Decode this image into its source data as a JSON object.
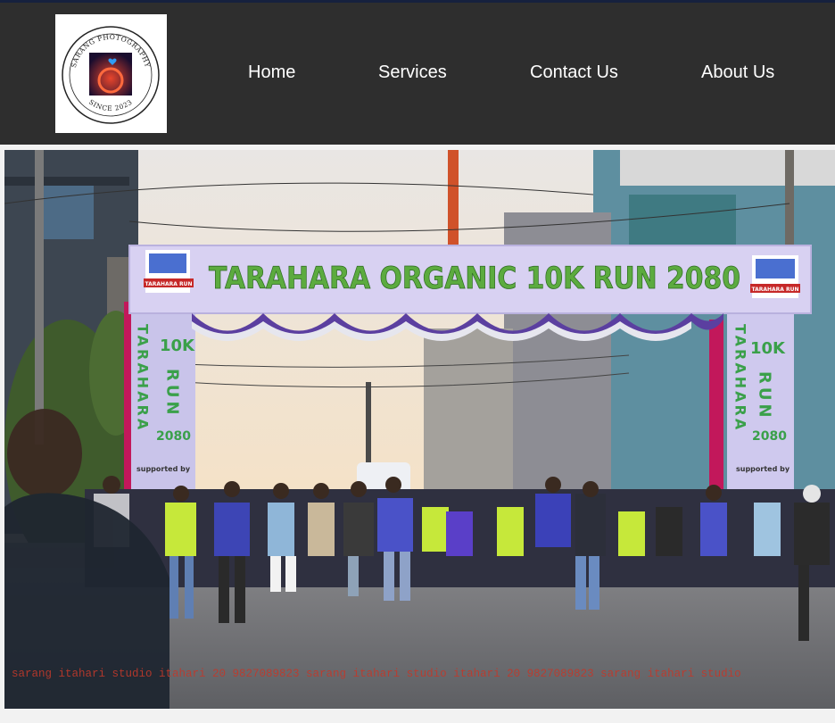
{
  "brand": {
    "logo_top_text": "SARANG PHOTOGRAPHY",
    "logo_bottom_text": "SINCE 2023"
  },
  "nav": {
    "items": [
      {
        "label": "Home"
      },
      {
        "label": "Services"
      },
      {
        "label": "Contact Us"
      },
      {
        "label": "About Us"
      }
    ]
  },
  "hero": {
    "banner_title": "TARAHARA ORGANIC 10K RUN 2080",
    "left_pillar_vertical": "TARAHARA",
    "pillar_10k": "10K",
    "pillar_run_vertical": "RUN",
    "pillar_year": "2080",
    "supported_by": "supported by",
    "badge_text": "TARAHARA RUN",
    "watermark": "sarang itahari studio itahari 20 9827089823 sarang itahari studio itahari 20 9827089823 sarang itahari studio"
  },
  "colors": {
    "header_bg": "#2e2e2e",
    "top_line": "#16213e",
    "nav_text": "#ffffff",
    "banner_bg": "#d6cff0",
    "banner_text": "#4caf50",
    "watermark": "#c0392b"
  }
}
